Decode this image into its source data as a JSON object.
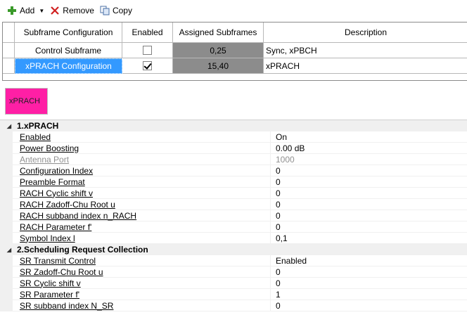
{
  "toolbar": {
    "add_label": "Add",
    "remove_label": "Remove",
    "copy_label": "Copy"
  },
  "grid": {
    "headers": [
      "Subframe Configuration",
      "Enabled",
      "Assigned Subframes",
      "Description"
    ],
    "rows": [
      {
        "name": "Control Subframe",
        "enabled": false,
        "subframes": "0,25",
        "description": "Sync, xPBCH"
      },
      {
        "name": "xPRACH Configuration",
        "enabled": true,
        "subframes": "15,40",
        "description": "xPRACH"
      }
    ]
  },
  "tile": {
    "label": "xPRACH",
    "color": "#ff1fa5"
  },
  "properties": {
    "sections": [
      {
        "title": "1.xPRACH",
        "items": [
          {
            "name": "Enabled",
            "value": "On"
          },
          {
            "name": "Power Boosting",
            "value": "0.00 dB"
          },
          {
            "name": "Antenna Port",
            "value": "1000"
          },
          {
            "name": "Configuration Index",
            "value": "0"
          },
          {
            "name": "Preamble Format",
            "value": "0"
          },
          {
            "name": "RACH Cyclic shift v",
            "value": "0"
          },
          {
            "name": "RACH Zadoff-Chu Root u",
            "value": "0"
          },
          {
            "name": "RACH subband index n_RACH",
            "value": "0"
          },
          {
            "name": "RACH Parameter f'",
            "value": "0"
          },
          {
            "name": "Symbol Index l",
            "value": "0,1"
          }
        ]
      },
      {
        "title": "2.Scheduling Request Collection",
        "items": [
          {
            "name": "SR Transmit Control",
            "value": "Enabled"
          },
          {
            "name": "SR Zadoff-Chu Root u",
            "value": "0"
          },
          {
            "name": "SR Cyclic shift v",
            "value": "0"
          },
          {
            "name": "SR Parameter f'",
            "value": "1"
          },
          {
            "name": "SR subband index N_SR",
            "value": "0"
          }
        ]
      }
    ]
  },
  "colors": {
    "selection": "#3399ff",
    "gray_cell": "#8c8c8c",
    "add_icon": "#3a9a2a",
    "remove_icon": "#d02020"
  }
}
